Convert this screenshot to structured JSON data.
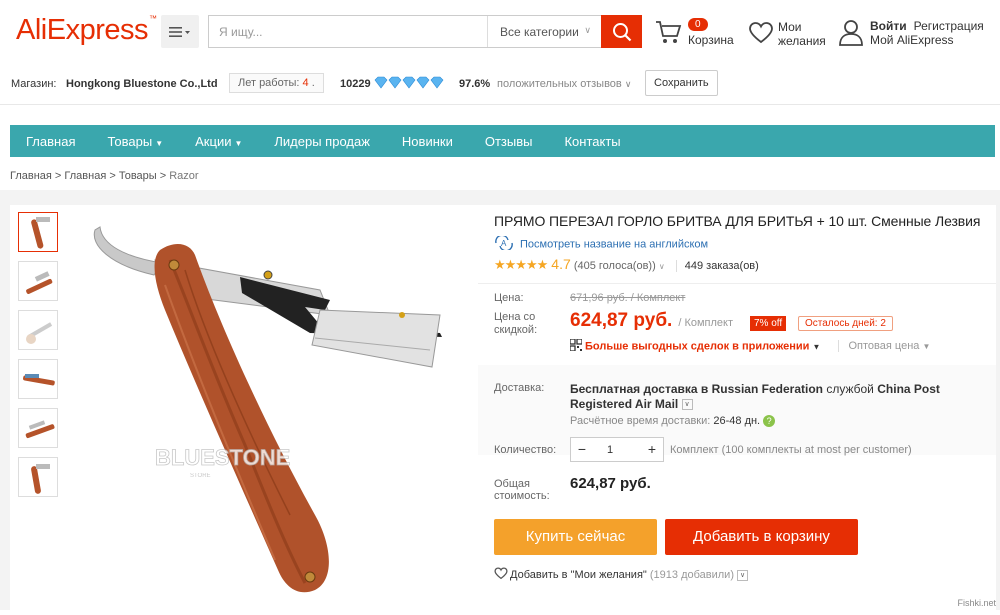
{
  "header": {
    "logo": "AliExpress",
    "search_placeholder": "Я ищу...",
    "category": "Все категории",
    "cart_count": "0",
    "cart_label": "Корзина",
    "wishlist_label": "Мои желания",
    "login": "Войти",
    "register": "Регистрация",
    "my_account": "Мой AliExpress"
  },
  "store": {
    "label": "Магазин:",
    "name": "Hongkong Bluestone Co.,Ltd",
    "years_label": "Лет работы:",
    "years": "4",
    "score": "10229",
    "feedback_pct": "97.6%",
    "feedback_label": "положительных отзывов",
    "save": "Сохранить"
  },
  "nav": [
    "Главная",
    "Товары",
    "Акции",
    "Лидеры продаж",
    "Новинки",
    "Отзывы",
    "Контакты"
  ],
  "breadcrumb": [
    "Главная",
    "Главная",
    "Товары",
    "Razor"
  ],
  "product": {
    "title": "ПРЯМО ПЕРЕЗАЛ ГОРЛО БРИТВА ДЛЯ БРИТЬЯ + 10 шт. Сменные Лезвия",
    "translate": "Посмотреть название на английском",
    "rating": "4.7",
    "votes": "(405 голоса(ов))",
    "orders": "449 заказа(ов)",
    "price_label": "Цена:",
    "old_price": "671,96 руб. / Комплект",
    "discount_label_1": "Цена со",
    "discount_label_2": "скидкой:",
    "new_price": "624,87 руб.",
    "unit": "/ Комплект",
    "off": "7% off",
    "days_left": "Осталось дней: 2",
    "app_deals": "Больше выгодных сделок в приложении",
    "wholesale": "Оптовая цена",
    "delivery_label": "Доставка:",
    "delivery_1": "Бесплатная доставка в",
    "delivery_country": "Russian Federation",
    "delivery_2": "службой",
    "delivery_carrier": "China Post Registered Air Mail",
    "delivery_time_label": "Расчётное время доставки:",
    "delivery_time": "26-48 дн.",
    "qty_label": "Количество:",
    "qty": "1",
    "qty_note": "Комплект (100 комплекты at most per customer)",
    "total_label_1": "Общая",
    "total_label_2": "стоимость:",
    "total": "624,87 руб.",
    "buy_now": "Купить сейчас",
    "add_cart": "Добавить в корзину",
    "wishlist_add": "Добавить в \"Мои желания\"",
    "wishlist_count": "(1913 добавили)"
  },
  "watermark": "Fishki.net",
  "colors": {
    "accent": "#e62e04",
    "nav": "#3aa7ad",
    "buy": "#f4a12b"
  }
}
